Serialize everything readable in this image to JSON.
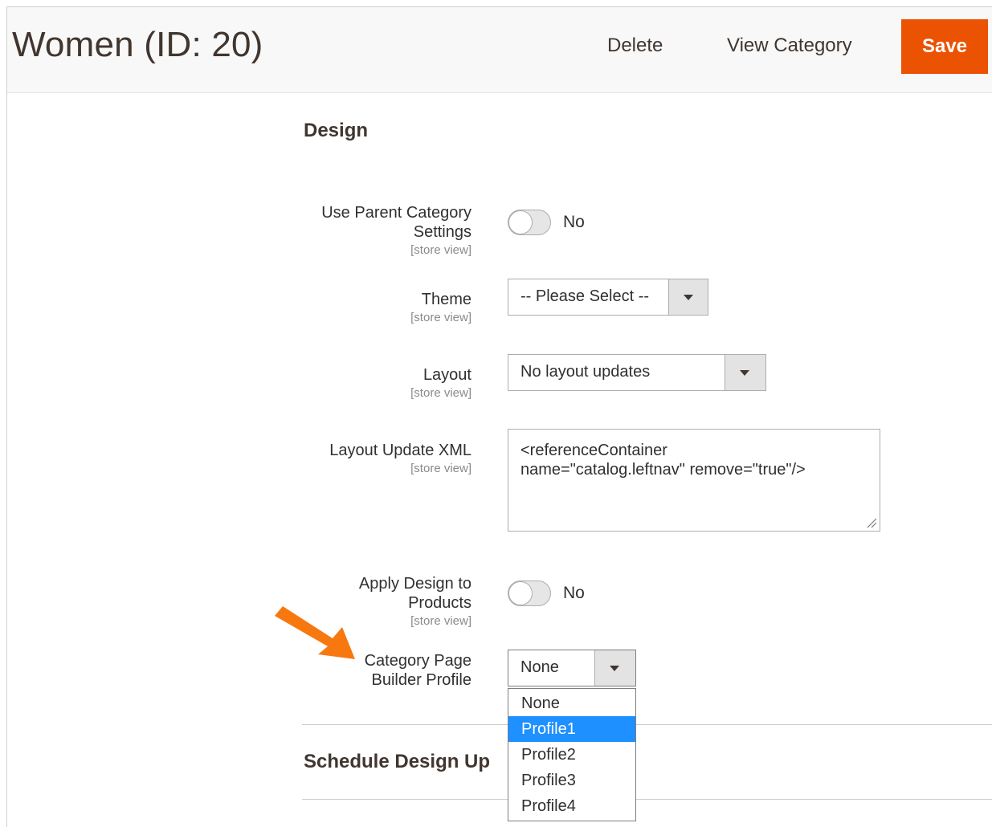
{
  "header": {
    "title": "Women (ID: 20)",
    "delete_label": "Delete",
    "view_category_label": "View Category",
    "save_label": "Save"
  },
  "design": {
    "section_title": "Design",
    "scope_label": "[store view]",
    "use_parent": {
      "label_line1": "Use Parent Category",
      "label_line2": "Settings",
      "value": "No"
    },
    "theme": {
      "label": "Theme",
      "value": "-- Please Select --"
    },
    "layout": {
      "label": "Layout",
      "value": "No layout updates"
    },
    "layout_xml": {
      "label": "Layout Update XML",
      "line1": "<referenceContainer",
      "line2": "name=\"catalog.leftnav\" remove=\"true\"/>"
    },
    "apply_design": {
      "label_line1": "Apply Design to",
      "label_line2": "Products",
      "value": "No"
    },
    "page_builder": {
      "label_line1": "Category Page",
      "label_line2": "Builder Profile",
      "value": "None",
      "options": [
        "None",
        "Profile1",
        "Profile2",
        "Profile3",
        "Profile4"
      ],
      "highlighted": "Profile1"
    }
  },
  "schedule": {
    "section_title": "Schedule Design Up"
  },
  "colors": {
    "accent": "#eb5202",
    "highlight": "#1e90ff",
    "annotation_arrow": "#f7780f"
  }
}
